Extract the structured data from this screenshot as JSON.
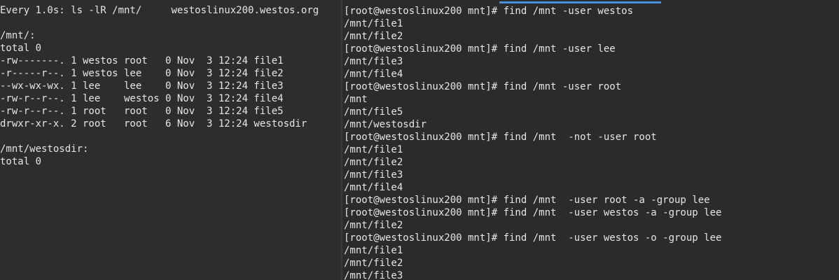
{
  "left_pane": {
    "header_command": "Every 1.0s: ls -lR /mnt/",
    "header_host": "westoslinux200.westos.org",
    "lines": [
      "",
      "/mnt/:",
      "total 0",
      "-rw-------. 1 westos root   0 Nov  3 12:24 file1",
      "-r-----r--. 1 westos lee    0 Nov  3 12:24 file2",
      "--wx-wx-wx. 1 lee    lee    0 Nov  3 12:24 file3",
      "-rw-r--r--. 1 lee    westos 0 Nov  3 12:24 file4",
      "-rw-r--r--. 1 root   root   0 Nov  3 12:24 file5",
      "drwxr-xr-x. 2 root   root   6 Nov  3 12:24 westosdir",
      "",
      "/mnt/westosdir:",
      "total 0"
    ]
  },
  "right_pane": {
    "lines": [
      "[root@westoslinux200 mnt]# find /mnt -user westos",
      "/mnt/file1",
      "/mnt/file2",
      "[root@westoslinux200 mnt]# find /mnt -user lee",
      "/mnt/file3",
      "/mnt/file4",
      "[root@westoslinux200 mnt]# find /mnt -user root",
      "/mnt",
      "/mnt/file5",
      "/mnt/westosdir",
      "[root@westoslinux200 mnt]# find /mnt  -not -user root",
      "/mnt/file1",
      "/mnt/file2",
      "/mnt/file3",
      "/mnt/file4",
      "[root@westoslinux200 mnt]# find /mnt  -user root -a -group lee",
      "[root@westoslinux200 mnt]# find /mnt  -user westos -a -group lee",
      "/mnt/file2",
      "[root@westoslinux200 mnt]# find /mnt  -user westos -o -group lee",
      "/mnt/file1",
      "/mnt/file2",
      "/mnt/file3"
    ]
  },
  "colors": {
    "background": "#2b2b2b",
    "text": "#e6e6e6",
    "active_tab_indicator": "#4a90d9"
  }
}
